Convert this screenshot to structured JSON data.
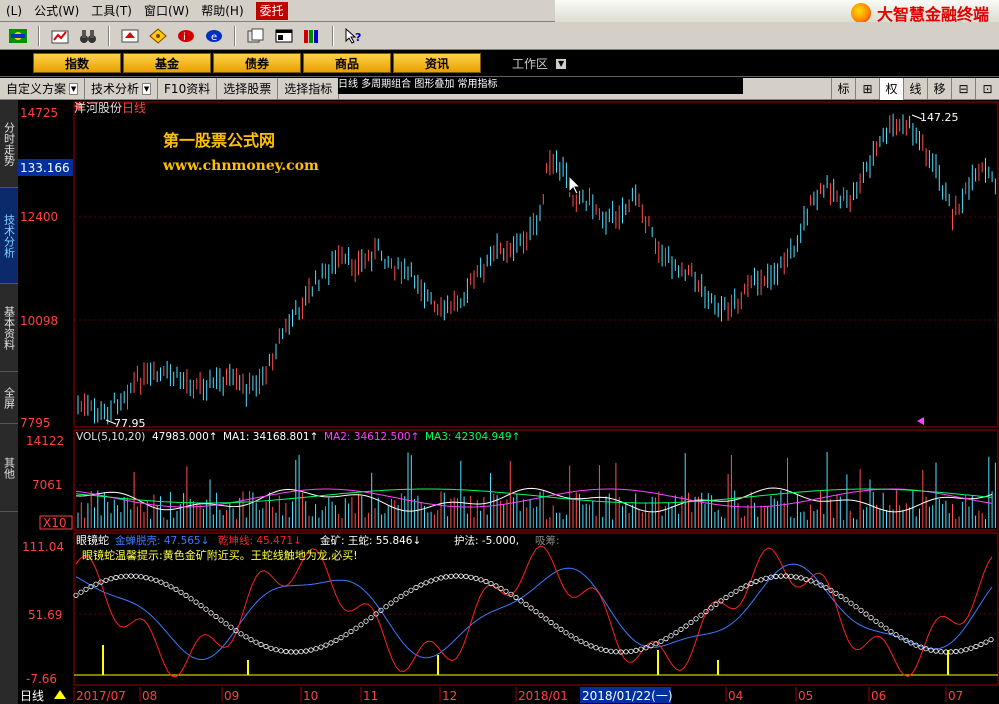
{
  "menu": {
    "items": [
      "公式(W)",
      "工具(T)",
      "窗口(W)",
      "帮助(H)"
    ],
    "cut_item": "(L)",
    "entrust": "委托",
    "brand": "大智慧金融终端"
  },
  "toolbar": {
    "icons": [
      "flag-icon",
      "quote-icon",
      "binoculars-icon",
      "message-icon",
      "diamond-icon",
      "info-icon",
      "compass-icon",
      "copy-icon",
      "window-icon",
      "books-icon",
      "help-pointer-icon"
    ]
  },
  "categories": [
    "指数",
    "基金",
    "债券",
    "商品",
    "资讯"
  ],
  "workzone_label": "工作区",
  "functabs": [
    "自定义方案",
    "技术分析",
    "F10资料",
    "选择股票",
    "选择指标"
  ],
  "dropbar_text": "日线    多周期组合    图形叠加    常用指标",
  "right_buttons": [
    "标",
    "⊞",
    "权",
    "线",
    "移",
    "⊟",
    "⊡"
  ],
  "sidebar": [
    "分时走势",
    "技术分析",
    "基本资料",
    "全屏",
    "其他"
  ],
  "stock": {
    "name": "洋河股份",
    "period": "日线"
  },
  "watermark": {
    "line1": "第一股票公式网",
    "line2": "www.chnmoney.com"
  },
  "price_axis": {
    "labels": [
      "14725",
      "133.166",
      "12400",
      "10098",
      "7795"
    ]
  },
  "price_marks": {
    "high": "147.25",
    "low": "77.95"
  },
  "volume": {
    "label": "VOL(5,10,20)",
    "vol_value": "47983.000↑",
    "ma1": "MA1: 34168.801↑",
    "ma2": "MA2: 34612.500↑",
    "ma3": "MA3: 42304.949↑",
    "axis": [
      "14122",
      "7061",
      "X10"
    ]
  },
  "indicator": {
    "name": "眼镜蛇",
    "items": [
      {
        "text": "金蝉脱壳: 47.565↓",
        "color": "#3a7bff"
      },
      {
        "text": "乾坤线: 45.471↓",
        "color": "#ff2020"
      },
      {
        "text": "金矿: 王蛇: 55.846↓",
        "color": "#ffffff"
      },
      {
        "text": "护法: -5.000,",
        "color": "#ffffff"
      },
      {
        "text": "吸筹:",
        "color": "#888888"
      }
    ],
    "hint": "眼镜蛇温馨提示:黄色金矿附近买。王蛇线触地为龙,必买!",
    "axis": [
      "111.04",
      "51.69",
      "-7.66"
    ]
  },
  "date_axis": {
    "period_label": "日线",
    "labels": [
      "2017/07",
      "08",
      "09",
      "10",
      "11",
      "12",
      "2018/01",
      "04",
      "05",
      "06",
      "07"
    ],
    "cursor": "2018/01/22(一)"
  }
}
